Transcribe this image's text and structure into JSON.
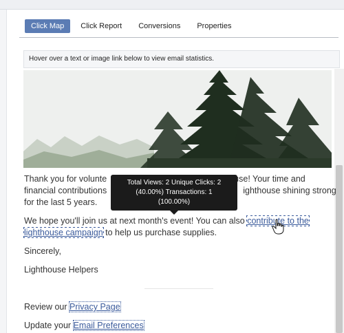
{
  "tabs": [
    {
      "label": "Click Map",
      "active": true
    },
    {
      "label": "Click Report",
      "active": false
    },
    {
      "label": "Conversions",
      "active": false
    },
    {
      "label": "Properties",
      "active": false
    }
  ],
  "hint": "Hover over a text or image link below to view email statistics.",
  "email": {
    "para1_start": "Thank you for volunte",
    "para1_end": "ouse! Your time and",
    "para1_line2_start": "financial contributions",
    "para1_line2_end": "ighthouse shining strong",
    "para1_line3": "for the last 5 years.",
    "para2_start": "We hope you'll join us at next month's event! You can also ",
    "link_contribute_1": "contribute to the",
    "link_contribute_2": "lighthouse campaign",
    "para2_end": " to help us purchase supplies.",
    "sincerely": "Sincerely,",
    "signature": "Lighthouse Helpers",
    "review_prefix": "Review our ",
    "privacy_link": "Privacy Page",
    "update_prefix": "Update your ",
    "preferences_link": "Email Preferences"
  },
  "tooltip": {
    "line1": "Total Views: 2 Unique Clicks: 2",
    "line2": "(40.00%) Transactions: 1",
    "line3": "(100.00%)"
  },
  "colors": {
    "active_tab": "#5b7cb4",
    "link": "#3a5a9b",
    "tooltip_bg": "#1b1b1b"
  }
}
